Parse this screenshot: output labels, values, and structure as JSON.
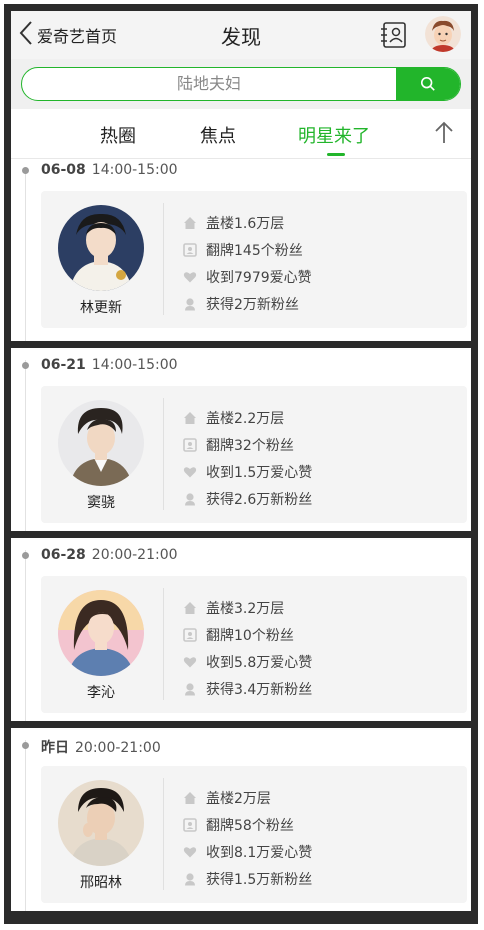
{
  "header": {
    "back_label": "爱奇艺首页",
    "title": "发现"
  },
  "search": {
    "placeholder": "陆地夫妇"
  },
  "tabs": [
    {
      "label": "热圈",
      "active": false
    },
    {
      "label": "焦点",
      "active": false
    },
    {
      "label": "明星来了",
      "active": true
    }
  ],
  "colors": {
    "accent": "#22b52b",
    "frame": "#2b2b2b",
    "card_bg": "#f4f4f4"
  },
  "entries": [
    {
      "date": "06-08",
      "time": "14:00-15:00",
      "star": "林更新",
      "stats": [
        {
          "icon": "house-icon",
          "text": "盖楼1.6万层"
        },
        {
          "icon": "badge-icon",
          "text": "翻牌145个粉丝"
        },
        {
          "icon": "heart-icon",
          "text": "收到7979爱心赞"
        },
        {
          "icon": "fan-icon",
          "text": "获得2万新粉丝"
        }
      ]
    },
    {
      "date": "06-21",
      "time": "14:00-15:00",
      "star": "窦骁",
      "stats": [
        {
          "icon": "house-icon",
          "text": "盖楼2.2万层"
        },
        {
          "icon": "badge-icon",
          "text": "翻牌32个粉丝"
        },
        {
          "icon": "heart-icon",
          "text": "收到1.5万爱心赞"
        },
        {
          "icon": "fan-icon",
          "text": "获得2.6万新粉丝"
        }
      ]
    },
    {
      "date": "06-28",
      "time": "20:00-21:00",
      "star": "李沁",
      "stats": [
        {
          "icon": "house-icon",
          "text": "盖楼3.2万层"
        },
        {
          "icon": "badge-icon",
          "text": "翻牌10个粉丝"
        },
        {
          "icon": "heart-icon",
          "text": "收到5.8万爱心赞"
        },
        {
          "icon": "fan-icon",
          "text": "获得3.4万新粉丝"
        }
      ]
    },
    {
      "date": "昨日",
      "time": "20:00-21:00",
      "star": "邢昭林",
      "stats": [
        {
          "icon": "house-icon",
          "text": "盖楼2万层"
        },
        {
          "icon": "badge-icon",
          "text": "翻牌58个粉丝"
        },
        {
          "icon": "heart-icon",
          "text": "收到8.1万爱心赞"
        },
        {
          "icon": "fan-icon",
          "text": "获得1.5万新粉丝"
        }
      ]
    }
  ]
}
